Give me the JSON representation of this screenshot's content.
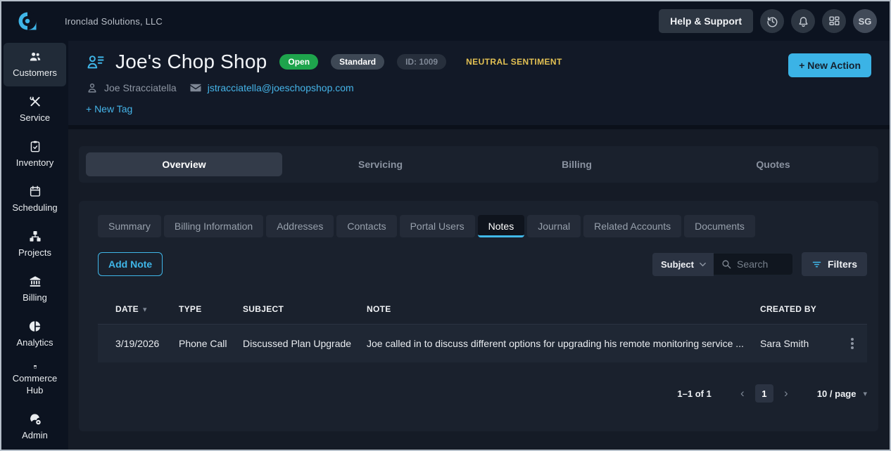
{
  "topbar": {
    "company_name": "Ironclad Solutions, LLC",
    "help_button": "Help & Support",
    "avatar_initials": "SG"
  },
  "sidebar": {
    "items": [
      {
        "label": "Customers",
        "icon": "customers-icon",
        "active": true
      },
      {
        "label": "Service",
        "icon": "service-icon",
        "active": false
      },
      {
        "label": "Inventory",
        "icon": "inventory-icon",
        "active": false
      },
      {
        "label": "Scheduling",
        "icon": "scheduling-icon",
        "active": false
      },
      {
        "label": "Projects",
        "icon": "projects-icon",
        "active": false
      },
      {
        "label": "Billing",
        "icon": "billing-icon",
        "active": false
      },
      {
        "label": "Analytics",
        "icon": "analytics-icon",
        "active": false
      },
      {
        "label": "Commerce Hub",
        "icon": "commerce-hub-icon",
        "active": false
      },
      {
        "label": "Admin",
        "icon": "admin-icon",
        "active": false
      }
    ]
  },
  "header": {
    "title": "Joe's Chop Shop",
    "status_badge": "Open",
    "plan_badge": "Standard",
    "id_badge": "ID: 1009",
    "sentiment_label": "NEUTRAL SENTIMENT",
    "new_action_button": "+ New Action",
    "contact_name": "Joe Stracciatella",
    "contact_email": "jstracciatella@joeschopshop.com",
    "new_tag_link": "+ New Tag"
  },
  "tabs": [
    {
      "label": "Overview",
      "active": true
    },
    {
      "label": "Servicing",
      "active": false
    },
    {
      "label": "Billing",
      "active": false
    },
    {
      "label": "Quotes",
      "active": false
    }
  ],
  "subtabs": [
    {
      "label": "Summary",
      "active": false
    },
    {
      "label": "Billing Information",
      "active": false
    },
    {
      "label": "Addresses",
      "active": false
    },
    {
      "label": "Contacts",
      "active": false
    },
    {
      "label": "Portal Users",
      "active": false
    },
    {
      "label": "Notes",
      "active": true
    },
    {
      "label": "Journal",
      "active": false
    },
    {
      "label": "Related Accounts",
      "active": false
    },
    {
      "label": "Documents",
      "active": false
    }
  ],
  "notes": {
    "add_note_button": "Add Note",
    "search_category": "Subject",
    "search_placeholder": "Search",
    "filters_button": "Filters",
    "table": {
      "columns": [
        "DATE",
        "TYPE",
        "SUBJECT",
        "NOTE",
        "CREATED BY"
      ],
      "rows": [
        {
          "date": "3/19/2026",
          "type": "Phone Call",
          "subject": "Discussed Plan Upgrade",
          "note": "Joe called in to discuss different options for upgrading his remote monitoring service ...",
          "created_by": "Sara Smith"
        }
      ]
    },
    "pagination": {
      "range_label": "1–1 of 1",
      "current_page": "1",
      "page_size_label": "10 / page"
    }
  },
  "glyphs": {
    "sort_desc": "▾",
    "dropdown_arrow": "▾",
    "chevron_left": "‹",
    "chevron_right": "›"
  },
  "colors": {
    "accent_cyan": "#3fb6e8",
    "status_open_green": "#1ea44c",
    "sentiment_yellow": "#e2c053",
    "background_dark": "#0c1320",
    "card_background": "#1a212d"
  }
}
